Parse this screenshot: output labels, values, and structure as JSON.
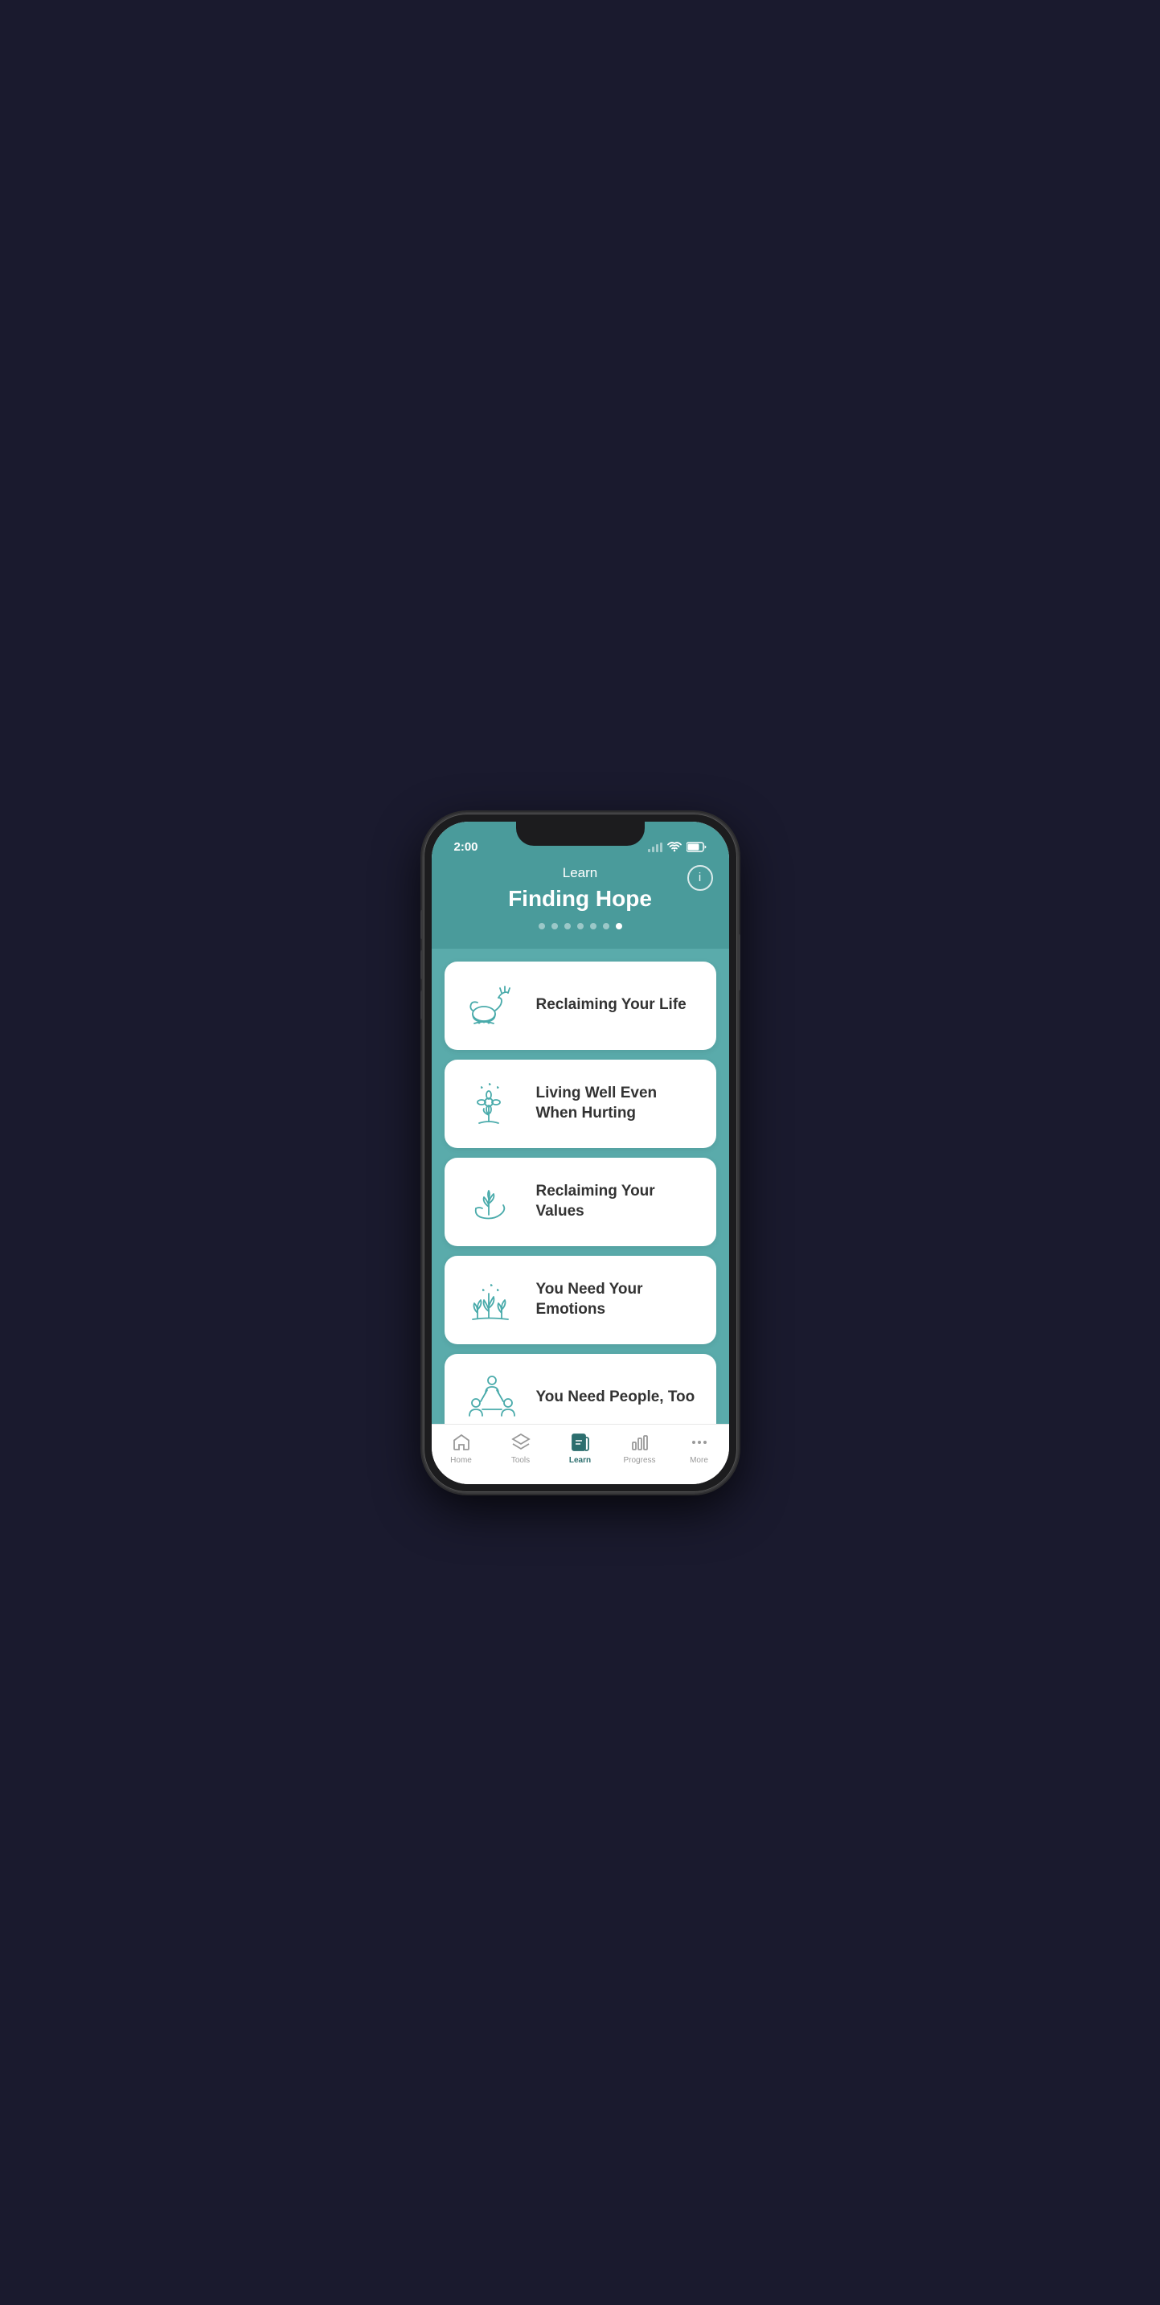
{
  "status": {
    "time": "2:00",
    "bg_color": "#4a9b9b"
  },
  "header": {
    "nav_title": "Learn",
    "main_title": "Finding Hope",
    "info_label": "i",
    "dots_count": 7,
    "active_dot": 6
  },
  "cards": [
    {
      "id": 1,
      "title": "Reclaiming Your Life",
      "icon": "watering-can"
    },
    {
      "id": 2,
      "title": "Living Well Even\nWhen Hurting",
      "icon": "flower-drops"
    },
    {
      "id": 3,
      "title": "Reclaiming Your Values",
      "icon": "hand-plant"
    },
    {
      "id": 4,
      "title": "You Need Your Emotions",
      "icon": "sprout-drops"
    },
    {
      "id": 5,
      "title": "You Need People, Too",
      "icon": "people-network"
    }
  ],
  "bottom_nav": {
    "items": [
      {
        "id": "home",
        "label": "Home",
        "icon": "home-icon",
        "active": false
      },
      {
        "id": "tools",
        "label": "Tools",
        "icon": "layers-icon",
        "active": false
      },
      {
        "id": "learn",
        "label": "Learn",
        "icon": "book-icon",
        "active": true
      },
      {
        "id": "progress",
        "label": "Progress",
        "icon": "bar-chart-icon",
        "active": false
      },
      {
        "id": "more",
        "label": "More",
        "icon": "dots-icon",
        "active": false
      }
    ]
  }
}
